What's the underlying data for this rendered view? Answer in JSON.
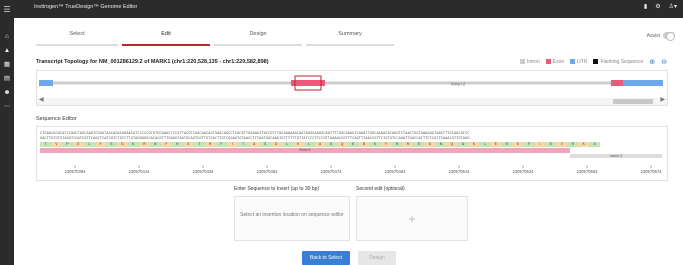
{
  "app": {
    "title": "Invitrogen™ TrueDesign™ Genome Editor"
  },
  "header": {
    "right_label": " —"
  },
  "tabs": [
    {
      "label": "Select",
      "active": false
    },
    {
      "label": "Edit",
      "active": true
    },
    {
      "label": "Design",
      "active": false
    },
    {
      "label": "Summary",
      "active": false
    }
  ],
  "toggle": {
    "label": "Assist"
  },
  "transcript": {
    "heading": "Transcript Topology for NM_001286129.2 of MARK1 (chr1:220,528,135 - chr1:220,582,898)",
    "legend": [
      {
        "label": "Intron",
        "color": "#cccccc"
      },
      {
        "label": "Exon",
        "color": "#e85a7a"
      },
      {
        "label": "UTR",
        "color": "#6fa8e8"
      },
      {
        "label": "Flanking Sequence",
        "color": "#111111"
      }
    ],
    "intron_label": "Intron 2"
  },
  "sequence_editor": {
    "label": "Sequence Editor",
    "top_strand": "CTGAACACACATCCAGCTAGCAAGTCGAGTAGCAGACAGAACATCCCCCGTGTGCAAACTCCATTACGTCAGCAACAGTGAACAGCCTCACATTGGAAATTACCGTTTACAAAAAACAATAGGGAAGGCAATTTTGGCAAAGTCAAATTGGCAAGACACAGGTCTAACTGGTAAAGAGTAAGTTTGCAACATCC",
    "bottom_strand": "GACTTGTGTGTAGGTCGATCGTTCAGCTCATCGTCTGTCTTGTAGGGGGCACACGTTTGAGGTAATGCAGTCGTTGTCACTTGTCGGAGTGTAACCTTTAATGGCAAATGTTTTTTGTTATCCCTTCCGTTAAAACCGTTTCAGTTTAACCGTTCTGTGTCCAGATTGACCATTTCTCATTCAAACGTTGTAGG",
    "amino_acids": [
      "T",
      "V",
      "P",
      "E",
      "L",
      "Y",
      "S",
      "G",
      "E",
      "R",
      "N",
      "F",
      "H",
      "S",
      "T",
      "R",
      "F",
      "I",
      "T",
      "A",
      "S",
      "D",
      "L",
      "K",
      "L",
      "A",
      "S",
      "Q",
      "E",
      "N",
      "K",
      "Y",
      "R",
      "R",
      "E",
      "S",
      "N",
      "Q",
      "A",
      "K",
      "L",
      "E",
      "R",
      "E",
      "F",
      "I",
      "E",
      "V",
      "R",
      "K",
      "A"
    ],
    "exon_label": "Exon 3",
    "intron_label": "Intron 3",
    "positions": [
      "220570394",
      "220570414",
      "220570434",
      "220570454",
      "220570474",
      "220570494",
      "220570514",
      "220570534",
      "220570554",
      "220570574"
    ]
  },
  "insert": {
    "label": "Enter Sequence to Insert (up to 30 bp)",
    "placeholder": "Select an insertion location on sequence editor"
  },
  "second_edit": {
    "label": "Second edit (optional)",
    "plus": "+"
  },
  "buttons": {
    "back": "Back to Select",
    "design": "Design"
  }
}
